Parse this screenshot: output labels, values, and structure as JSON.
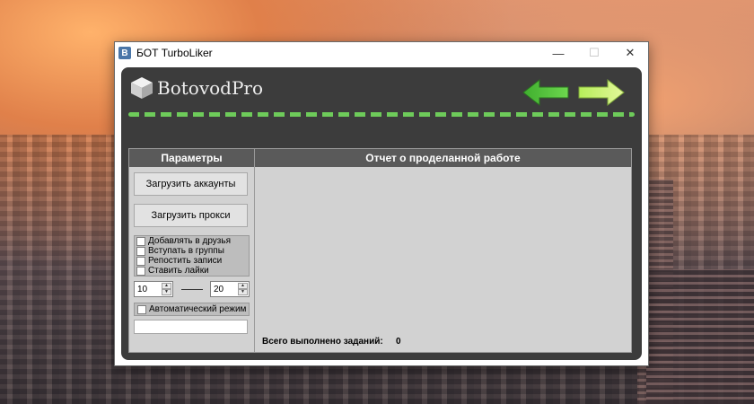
{
  "window": {
    "title": "БОТ TurboLiker",
    "icon_letter": "B",
    "controls": {
      "minimize": "—",
      "maximize": "☐",
      "close": "✕"
    }
  },
  "brand": {
    "logo_text": "BotovodPro",
    "accent_color": "#6ecb5a"
  },
  "panel": {
    "params_header": "Параметры",
    "report_header": "Отчет о проделанной работе",
    "load_accounts_label": "Загрузить аккаунты",
    "load_proxy_label": "Загрузить прокси",
    "options": [
      {
        "label": "Добавлять в друзья"
      },
      {
        "label": "Вступать в группы"
      },
      {
        "label": "Репостить записи"
      },
      {
        "label": "Ставить лайки"
      }
    ],
    "range_from": "10",
    "range_to": "20",
    "auto_mode_label": "Автоматический режим",
    "status_value": "",
    "total_label": "Всего выполнено заданий:",
    "total_value": "0"
  },
  "icons": {
    "back": "arrow-left-icon",
    "forward": "arrow-right-icon",
    "logo": "cube-icon"
  }
}
